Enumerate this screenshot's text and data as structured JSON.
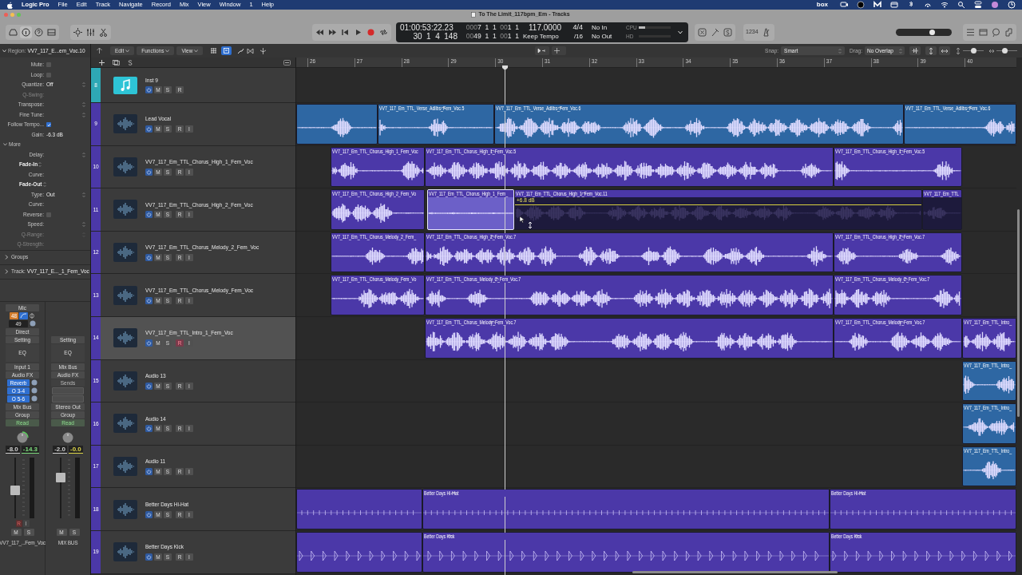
{
  "menu_bar": {
    "app": "Logic Pro",
    "items": [
      "File",
      "Edit",
      "Track",
      "Navigate",
      "Record",
      "Mix",
      "View",
      "Window",
      "1",
      "Help"
    ],
    "extra_text": "box"
  },
  "window": {
    "title": "To The Limit_117bpm_Em - Tracks"
  },
  "lcd": {
    "time": "01:00:53:22.23",
    "position": "30  1  4  148",
    "top_dim": "000",
    "top_bars": "7  1  1  ",
    "top_dim2": "00",
    "top_tail": "1  1",
    "bottom_dim": "00",
    "bottom_bars": "49  1  1  ",
    "bottom_dim2": "00",
    "bottom_tail": "1  1",
    "tempo": "117.0000",
    "tempo_mode": "Keep Tempo",
    "signature": "4/4",
    "division": "/16",
    "midi_in": "No In",
    "midi_out": "No Out",
    "cpu_label": "CPU",
    "hd_label": "HD",
    "cpu_meter": {
      "level": 0.2
    }
  },
  "count_in": "1234",
  "master_volume": {
    "level": 0.67
  },
  "control_bar": {
    "region_label": "Region:",
    "region_name": "VV7_117_E...em_Voc.10",
    "menus": [
      "Edit",
      "Functions",
      "View"
    ],
    "snap_label": "Snap:",
    "snap": "Smart",
    "drag_label": "Drag:",
    "drag": "No Overlap",
    "zoom_vertical": {
      "level": 0.5
    },
    "zoom_horizontal": {
      "level": 0.4
    }
  },
  "inspector": {
    "params": [
      {
        "label": "Mute:",
        "kind": "checkbox",
        "checked": false,
        "disabled": false
      },
      {
        "label": "Loop:",
        "kind": "checkbox",
        "checked": false,
        "disabled": false
      },
      {
        "label": "Quantize:",
        "value": "Off",
        "kind": "popup",
        "disabled": false
      },
      {
        "label": "Q-Swing:",
        "kind": "field",
        "disabled": true
      },
      {
        "label": "Transpose:",
        "kind": "popup",
        "disabled": false
      },
      {
        "label": "Fine Tune:",
        "kind": "popup",
        "disabled": false
      },
      {
        "label": "Follow Tempo...",
        "kind": "checkbox",
        "checked": true,
        "disabled": false
      },
      {
        "label": "Gain:",
        "value": "-6.3 dB",
        "kind": "field",
        "disabled": false
      },
      {
        "label": "More",
        "kind": "section",
        "disabled": false
      },
      {
        "label": "Delay:",
        "kind": "popup",
        "disabled": false
      },
      {
        "label": "Fade-In",
        "kind": "heading",
        "disabled": false
      },
      {
        "label": "Curve:",
        "kind": "field",
        "disabled": false
      },
      {
        "label": "Fade-Out",
        "kind": "heading",
        "disabled": false
      },
      {
        "label": "Type:",
        "value": "Out",
        "kind": "popup",
        "disabled": false
      },
      {
        "label": "Curve:",
        "kind": "field",
        "disabled": false
      },
      {
        "label": "Reverse:",
        "kind": "checkbox",
        "checked": false,
        "disabled": false
      },
      {
        "label": "Speed:",
        "kind": "popup",
        "disabled": false
      },
      {
        "label": "Q-Range:",
        "kind": "popup",
        "disabled": true
      },
      {
        "label": "Q-Strength:",
        "kind": "field",
        "disabled": true
      }
    ],
    "sections": [
      {
        "label": "Groups",
        "expanded": false
      },
      {
        "label": "Track:",
        "value": "VV7_117_E..._1_Fem_Voc",
        "expanded": false
      }
    ]
  },
  "channel_strips": [
    {
      "kind": "track",
      "slots": [
        {
          "kind": "button",
          "text": "Mic"
        },
        {
          "kind": "gain",
          "text": "48"
        },
        {
          "kind": "trim",
          "text": "49"
        },
        {
          "kind": "button",
          "text": "Direct"
        },
        {
          "kind": "button",
          "text": "Setting"
        },
        {
          "kind": "eq",
          "text": "EQ"
        },
        {
          "kind": "io",
          "text": "Input 1"
        },
        {
          "kind": "button",
          "text": "Audio FX"
        },
        {
          "kind": "send",
          "text": "Reverb"
        },
        {
          "kind": "send",
          "text": "O 3-4"
        },
        {
          "kind": "send",
          "text": "O 5-6"
        },
        {
          "kind": "button",
          "text": "Mix Bus"
        },
        {
          "kind": "button",
          "text": "Group"
        },
        {
          "kind": "automation",
          "text": "Read"
        }
      ],
      "readings": [
        {
          "text": "-8.0",
          "color": "#d0d0d0"
        },
        {
          "text": "-14.3",
          "color": "#7ddc7d"
        }
      ],
      "fader": {
        "level": 0.45
      },
      "mute": "M",
      "solo": "S",
      "record": "R",
      "input": "I",
      "name": "VV7_117_...Fem_Voc"
    },
    {
      "kind": "bus",
      "slots": [
        {
          "kind": "spacer"
        },
        {
          "kind": "spacer"
        },
        {
          "kind": "spacer"
        },
        {
          "kind": "spacer"
        },
        {
          "kind": "button",
          "text": "Setting"
        },
        {
          "kind": "eq",
          "text": "EQ"
        },
        {
          "kind": "io",
          "text": "Mix Bus"
        },
        {
          "kind": "button",
          "text": "Audio FX"
        },
        {
          "kind": "send_empty",
          "text": "Sends"
        },
        {
          "kind": "empty"
        },
        {
          "kind": "empty"
        },
        {
          "kind": "button",
          "text": "Stereo Out"
        },
        {
          "kind": "button",
          "text": "Group"
        },
        {
          "kind": "automation",
          "text": "Read"
        }
      ],
      "readings": [
        {
          "text": "-2.0",
          "color": "#d0d0d0"
        },
        {
          "text": "-0.0",
          "color": "#e0d84a"
        }
      ],
      "fader": {
        "level": 0.7
      },
      "mute": "M",
      "solo": "S",
      "name": "MIX BUS"
    }
  ],
  "ruler": [
    "26",
    "27",
    "28",
    "29",
    "30",
    "31",
    "32",
    "33",
    "34",
    "35",
    "36",
    "37",
    "38",
    "39",
    "40"
  ],
  "tracks": [
    {
      "number": "8",
      "name": "Inst 9",
      "kind": "instrument",
      "color": "#2ea8b5",
      "selected": false,
      "armed": false,
      "buttons": [
        "M",
        "S",
        "R"
      ]
    },
    {
      "number": "9",
      "name": "Lead Vocal",
      "kind": "audio",
      "color": "#4b38a8",
      "selected": false,
      "armed": false,
      "buttons": [
        "M",
        "S",
        "R",
        "I"
      ],
      "regions": [
        {
          "kind": "vocal",
          "color": "#2e67a3",
          "selected": false,
          "marker": false
        },
        {
          "name": "VV7_117_Em_TTL_Verse_Adlibs_Fem_Voc.5",
          "kind": "vocal",
          "color": "#2e67a3",
          "selected": false,
          "marker": true
        },
        {
          "name": "VV7_117_Em_TTL_Verse_Adlibs_Fem_Voc.6",
          "kind": "vocal",
          "color": "#2e67a3",
          "selected": false,
          "marker": true
        },
        {
          "name": "VV7_117_Em_TTL_Verse_Adlibs_Fem_Voc.6",
          "kind": "vocal",
          "color": "#2e67a3",
          "selected": false,
          "marker": true
        }
      ]
    },
    {
      "number": "10",
      "name": "VV7_117_Em_TTL_Chorus_High_1_Fem_Voc",
      "kind": "audio",
      "color": "#4b38a8",
      "selected": false,
      "armed": false,
      "buttons": [
        "M",
        "S",
        "R",
        "I"
      ],
      "regions": [
        {
          "name": "VV7_117_Em_TTL_Chorus_High_1_Fem_Voc",
          "kind": "vocal",
          "color": "#4b38a8",
          "selected": false,
          "marker": false
        },
        {
          "name": "VV7_117_Em_TTL_Chorus_High_1_Fem_Voc.5",
          "kind": "vocal",
          "color": "#4b38a8",
          "selected": false,
          "marker": true
        },
        {
          "name": "VV7_117_Em_TTL_Chorus_High_1_Fem_Voc.5",
          "kind": "vocal",
          "color": "#4b38a8",
          "selected": false,
          "marker": true
        }
      ]
    },
    {
      "number": "11",
      "name": "VV7_117_Em_TTL_Chorus_High_2_Fem_Voc",
      "kind": "audio",
      "color": "#4b38a8",
      "selected": false,
      "armed": false,
      "buttons": [
        "M",
        "S",
        "R",
        "I"
      ],
      "regions": [
        {
          "name": "VV7_117_Em_TTL_Chorus_High_2_Fem_Vo",
          "kind": "vocal",
          "color": "#4b38a8",
          "selected": false,
          "marker": false
        },
        {
          "name": "VV7_117_Em_TTL_Chorus_High_1_Fem_",
          "kind": "quiet",
          "color": "#4b38a8",
          "selected": true,
          "marker": false
        },
        {
          "name": "VV7_117_Em_TTL_Chorus_High_1_Fem_Voc.11",
          "kind": "dim",
          "gain": "+6.8 dB",
          "color": "#4b38a8",
          "selected": false,
          "marker": true
        },
        {
          "name": "VV7_117_Em_TTL",
          "kind": "dim",
          "color": "#4b38a8",
          "selected": false,
          "marker": false
        }
      ]
    },
    {
      "number": "12",
      "name": "VV7_117_Em_TTL_Chorus_Melody_2_Fem_Voc",
      "kind": "audio",
      "color": "#4b38a8",
      "selected": false,
      "armed": false,
      "buttons": [
        "M",
        "S",
        "R",
        "I"
      ],
      "regions": [
        {
          "name": "VV7_117_Em_TTL_Chorus_Melody_2_Fem_",
          "kind": "vocal",
          "color": "#4b38a8",
          "selected": false,
          "marker": false
        },
        {
          "name": "VV7_117_Em_TTL_Chorus_High_2_Fem_Voc.7",
          "kind": "vocal",
          "color": "#4b38a8",
          "selected": false,
          "marker": true
        },
        {
          "name": "VV7_117_Em_TTL_Chorus_High_2_Fem_Voc.7",
          "kind": "vocal",
          "color": "#4b38a8",
          "selected": false,
          "marker": true
        }
      ]
    },
    {
      "number": "13",
      "name": "VV7_117_Em_TTL_Chorus_Melody_Fem_Voc",
      "kind": "audio",
      "color": "#4b38a8",
      "selected": false,
      "armed": false,
      "buttons": [
        "M",
        "S",
        "R",
        "I"
      ],
      "regions": [
        {
          "name": "VV7_117_Em_TTL_Chorus_Melody_Fem_Vo",
          "kind": "vocal",
          "color": "#4b38a8",
          "selected": false,
          "marker": false
        },
        {
          "name": "VV7_117_Em_TTL_Chorus_Melody_2_Fem_Voc.7",
          "kind": "vocal",
          "color": "#4b38a8",
          "selected": false,
          "marker": true
        },
        {
          "name": "VV7_117_Em_TTL_Chorus_Melody_2_Fem_Voc.7",
          "kind": "vocal",
          "color": "#4b38a8",
          "selected": false,
          "marker": true
        }
      ]
    },
    {
      "number": "14",
      "name": "VV7_117_Em_TTL_Intro_1_Fem_Voc",
      "kind": "audio",
      "color": "#4b38a8",
      "selected": true,
      "armed": true,
      "buttons": [
        "M",
        "S",
        "R",
        "I"
      ],
      "regions": [
        {
          "name": "VV7_117_Em_TTL_Chorus_Melody_Fem_Voc.7",
          "kind": "vocal",
          "color": "#4b38a8",
          "selected": false,
          "marker": true
        },
        {
          "name": "VV7_117_Em_TTL_Chorus_Melody_Fem_Voc.7",
          "kind": "vocal",
          "color": "#4b38a8",
          "selected": false,
          "marker": true
        },
        {
          "name": "VV7_117_Em_TTL_Intro_",
          "kind": "short",
          "color": "#4b38a8",
          "selected": false,
          "marker": false
        }
      ]
    },
    {
      "number": "15",
      "name": "Audio 13",
      "kind": "audio",
      "color": "#4b38a8",
      "selected": false,
      "armed": false,
      "buttons": [
        "M",
        "S",
        "R",
        "I"
      ],
      "regions": [
        {
          "name": "VV7_117_Em_TTL_Intro_",
          "kind": "short",
          "color": "#2e67a3",
          "selected": false,
          "marker": false
        }
      ]
    },
    {
      "number": "16",
      "name": "Audio 14",
      "kind": "audio",
      "color": "#4b38a8",
      "selected": false,
      "armed": false,
      "buttons": [
        "M",
        "S",
        "R",
        "I"
      ],
      "regions": [
        {
          "name": "VV7_117_Em_TTL_Intro_",
          "kind": "short",
          "color": "#2e67a3",
          "selected": false,
          "marker": false
        }
      ]
    },
    {
      "number": "17",
      "name": "Audio 11",
      "kind": "audio",
      "color": "#4b38a8",
      "selected": false,
      "armed": false,
      "buttons": [
        "M",
        "S",
        "R",
        "I"
      ],
      "regions": [
        {
          "name": "VV7_117_Em_TTL_Intro_",
          "kind": "short",
          "color": "#2e67a3",
          "selected": false,
          "marker": false
        }
      ]
    },
    {
      "number": "18",
      "name": "Better Days Hi-Hat",
      "kind": "audio",
      "color": "#4b38a8",
      "selected": false,
      "armed": false,
      "buttons": [
        "M",
        "S",
        "R",
        "I"
      ],
      "regions": [
        {
          "kind": "hihat",
          "color": "#4b38a8",
          "selected": false,
          "marker": false
        },
        {
          "name": "Better Days Hi-Hat",
          "kind": "hihat",
          "color": "#4b38a8",
          "selected": false,
          "marker": true
        },
        {
          "name": "Better Days Hi-Hat",
          "kind": "hihat",
          "color": "#4b38a8",
          "selected": false,
          "marker": true
        }
      ]
    },
    {
      "number": "19",
      "name": "Better Days Kick",
      "kind": "audio",
      "color": "#4b38a8",
      "selected": false,
      "armed": false,
      "buttons": [
        "M",
        "S",
        "R",
        "I"
      ],
      "regions": [
        {
          "kind": "kick",
          "color": "#4b38a8",
          "selected": false,
          "marker": false
        },
        {
          "name": "Better Days Kick",
          "kind": "kick",
          "color": "#4b38a8",
          "selected": false,
          "marker": true
        },
        {
          "name": "Better Days Kick",
          "kind": "kick",
          "color": "#4b38a8",
          "selected": false,
          "marker": true
        }
      ]
    }
  ]
}
